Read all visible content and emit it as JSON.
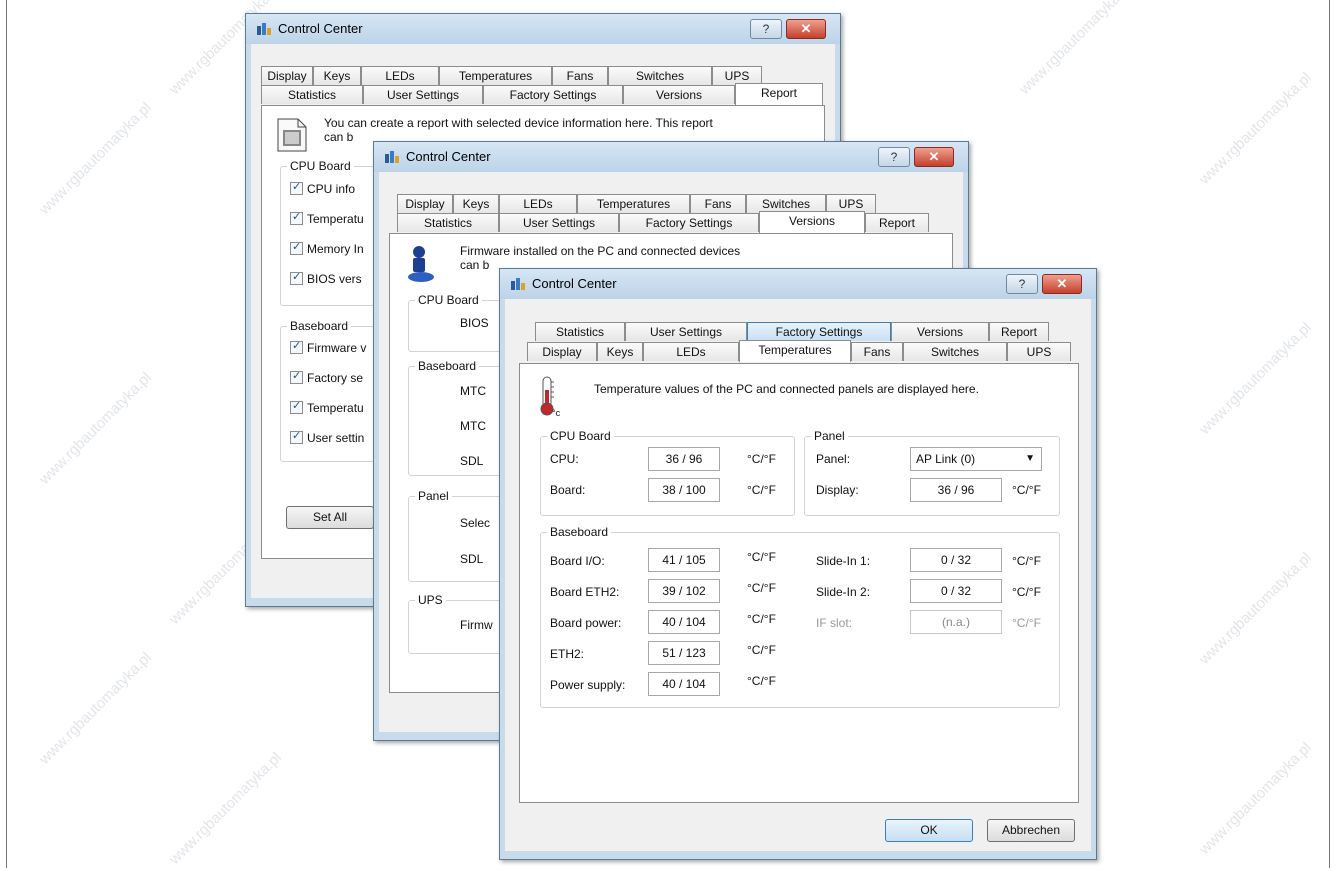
{
  "title": "Control Center",
  "help_glyph": "?",
  "close_glyph": "✕",
  "watermark": "www.rgbautomatyka.pl",
  "tabs": {
    "display": "Display",
    "keys": "Keys",
    "leds": "LEDs",
    "temperatures": "Temperatures",
    "fans": "Fans",
    "switches": "Switches",
    "ups": "UPS",
    "statistics": "Statistics",
    "user_settings": "User Settings",
    "factory_settings": "Factory Settings",
    "versions": "Versions",
    "report": "Report"
  },
  "report": {
    "info_line1": "You can create a report with selected device information here. This report",
    "info_line2": "can b",
    "cpu_board_group": "CPU Board",
    "cpu_items": [
      "CPU info",
      "Temperatu",
      "Memory In",
      "BIOS vers"
    ],
    "baseboard_group": "Baseboard",
    "baseboard_items": [
      "Firmware v",
      "Factory se",
      "Temperatu",
      "User settin"
    ],
    "set_all": "Set All"
  },
  "versions": {
    "info_line1": "Firmware installed on the PC and connected devices",
    "info_line2": "can b",
    "cpu_board_group": "CPU Board",
    "cpu_rows": [
      "BIOS"
    ],
    "baseboard_group": "Baseboard",
    "baseboard_rows": [
      "MTC",
      "MTC",
      "SDL"
    ],
    "panel_group": "Panel",
    "panel_rows": [
      "Selec",
      "SDL"
    ],
    "ups_group": "UPS",
    "ups_rows": [
      "Firmw"
    ]
  },
  "temperatures": {
    "info": "Temperature values of the PC and connected panels are displayed here.",
    "thermo_unit": "°c",
    "cpu_board_group": "CPU Board",
    "cpu_rows": [
      {
        "label": "CPU:",
        "value": "36 / 96",
        "unit": "°C/°F"
      },
      {
        "label": "Board:",
        "value": "38 / 100",
        "unit": "°C/°F"
      }
    ],
    "panel_group": "Panel",
    "panel_label": "Panel:",
    "panel_select": "AP Link (0)",
    "display_row": {
      "label": "Display:",
      "value": "36 / 96",
      "unit": "°C/°F"
    },
    "baseboard_group": "Baseboard",
    "baseboard_rows": [
      {
        "label": "Board I/O:",
        "value": "41 / 105",
        "unit": "°C/°F"
      },
      {
        "label": "Board ETH2:",
        "value": "39 / 102",
        "unit": "°C/°F"
      },
      {
        "label": "Board power:",
        "value": "40 / 104",
        "unit": "°C/°F"
      },
      {
        "label": "ETH2:",
        "value": "51 / 123",
        "unit": "°C/°F"
      },
      {
        "label": "Power supply:",
        "value": "40 / 104",
        "unit": "°C/°F"
      }
    ],
    "slide_rows": [
      {
        "label": "Slide-In 1:",
        "value": "0 / 32",
        "unit": "°C/°F"
      },
      {
        "label": "Slide-In 2:",
        "value": "0 / 32",
        "unit": "°C/°F"
      },
      {
        "label": "IF slot:",
        "value": "(n.a.)",
        "unit": "°C/°F"
      }
    ],
    "ok": "OK",
    "cancel": "Abbrechen"
  }
}
